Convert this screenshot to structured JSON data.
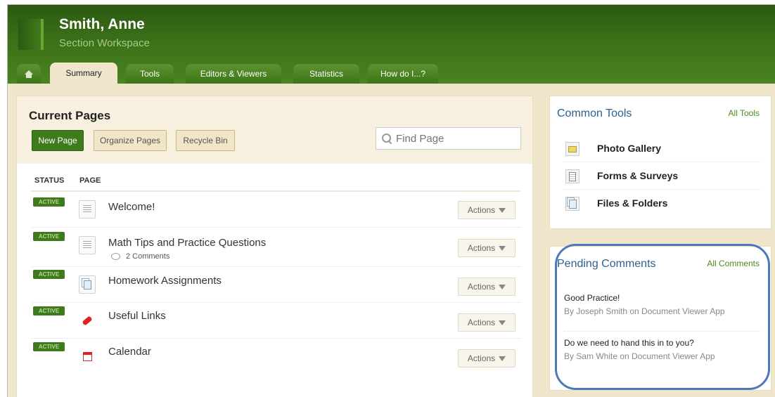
{
  "header": {
    "title": "Smith, Anne",
    "subtitle": "Section Workspace"
  },
  "tabs": [
    {
      "label": "Summary",
      "active": true
    },
    {
      "label": "Tools"
    },
    {
      "label": "Editors & Viewers"
    },
    {
      "label": "Statistics"
    },
    {
      "label": "How do I...?"
    }
  ],
  "current_pages": {
    "title": "Current Pages",
    "new_page": "New Page",
    "organize_pages": "Organize Pages",
    "recycle_bin": "Recycle Bin",
    "find_placeholder": "Find Page",
    "columns": {
      "status": "STATUS",
      "page": "PAGE"
    },
    "rows": [
      {
        "status": "ACTIVE",
        "title": "Welcome!",
        "icon": "page-icon",
        "actions": "Actions"
      },
      {
        "status": "ACTIVE",
        "title": "Math Tips and Practice Questions",
        "icon": "page-icon",
        "comments": "2 Comments",
        "actions": "Actions"
      },
      {
        "status": "ACTIVE",
        "title": "Homework Assignments",
        "icon": "documents-icon",
        "actions": "Actions"
      },
      {
        "status": "ACTIVE",
        "title": "Useful Links",
        "icon": "link-icon",
        "actions": "Actions"
      },
      {
        "status": "ACTIVE",
        "title": "Calendar",
        "icon": "calendar-icon",
        "actions": "Actions"
      }
    ]
  },
  "common_tools": {
    "title": "Common Tools",
    "all_link": "All Tools",
    "items": [
      {
        "label": "Photo Gallery",
        "icon": "photo-gallery-icon"
      },
      {
        "label": "Forms & Surveys",
        "icon": "forms-icon"
      },
      {
        "label": "Files & Folders",
        "icon": "files-icon"
      }
    ]
  },
  "pending_comments": {
    "title": "Pending Comments",
    "all_link": "All Comments",
    "items": [
      {
        "text": "Good Practice!",
        "by": "By Joseph Smith on Document Viewer App"
      },
      {
        "text": "Do we need to hand this in to you?",
        "by": "By Sam White on Document Viewer App"
      }
    ]
  },
  "colors": {
    "header_green": "#3b7018",
    "accent_green": "#3f7a1d",
    "link_blue": "#2e5f8f",
    "highlight_ring": "#4c7ab8",
    "page_bg": "#efe6cc"
  }
}
